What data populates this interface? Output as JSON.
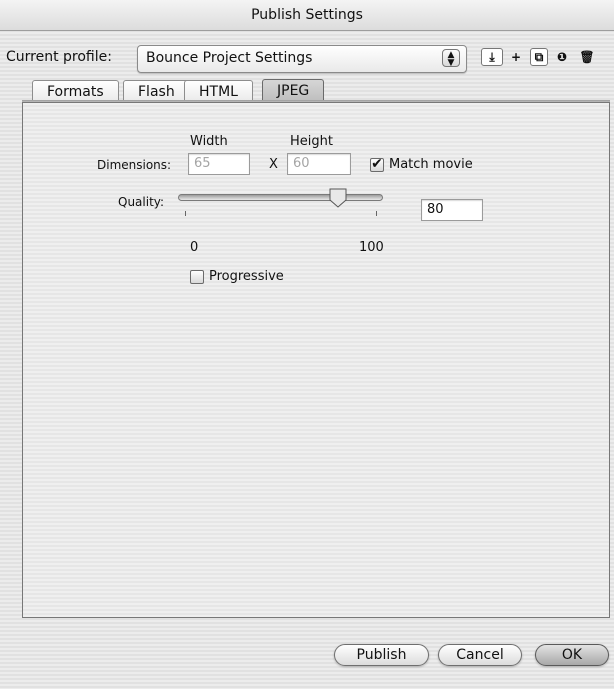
{
  "window": {
    "title": "Publish Settings"
  },
  "profile": {
    "label": "Current profile:",
    "value": "Bounce Project Settings"
  },
  "toolbar_icons": [
    "import-export-icon",
    "add-icon",
    "duplicate-icon",
    "info-icon",
    "trash-icon"
  ],
  "tabs": [
    {
      "label": "Formats",
      "active": false
    },
    {
      "label": "Flash",
      "active": false
    },
    {
      "label": "HTML",
      "active": false
    },
    {
      "label": "JPEG",
      "active": true
    }
  ],
  "jpeg": {
    "width_header": "Width",
    "height_header": "Height",
    "dimensions_label": "Dimensions:",
    "width_value": "65",
    "times_sign": "X",
    "height_value": "60",
    "match_movie_label": "Match movie",
    "match_movie_checked": true,
    "quality_label": "Quality:",
    "quality_value": "80",
    "quality_min": "0",
    "quality_max": "100",
    "quality_level": 80,
    "progressive_label": "Progressive",
    "progressive_checked": false
  },
  "buttons": {
    "publish": "Publish",
    "cancel": "Cancel",
    "ok": "OK"
  }
}
